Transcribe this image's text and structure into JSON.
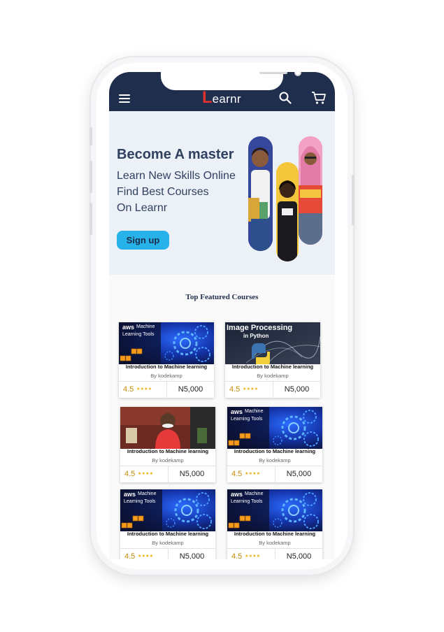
{
  "header": {
    "menu_icon": "hamburger-menu-icon",
    "logo_initial": "L",
    "logo_text": "earnr",
    "search_icon": "search-icon",
    "cart_icon": "shopping-cart-icon",
    "background": "#1f2e4d"
  },
  "hero": {
    "title": "Become A master",
    "lines": [
      "Learn New Skills Online",
      "Find Best Courses",
      "On Learnr"
    ],
    "signup_label": "Sign up",
    "accent": "#27b3e9"
  },
  "featured": {
    "title": "Top Featured Courses"
  },
  "courses": [
    {
      "thumb": "aws",
      "aws_logo": "aws",
      "aws_tag": "Machine",
      "aws_sub": "Learning Tools",
      "title": "Introduction to Machine learning",
      "author": "By kodekamp",
      "rating": "4.5",
      "stars": "★★★★",
      "price": "N5,000"
    },
    {
      "thumb": "image-processing",
      "ip_title": "Image Processing",
      "ip_sub": "in Python",
      "title": "Introduction to Machine learning",
      "author": "By kodekamp",
      "rating": "4.5",
      "stars": "★★★★",
      "price": "N5,000"
    },
    {
      "thumb": "photo",
      "title": "Introduction to Machine learning",
      "author": "By kodekamp",
      "rating": "4.5",
      "stars": "★★★★",
      "price": "N5,000"
    },
    {
      "thumb": "aws",
      "aws_logo": "aws",
      "aws_tag": "Machine",
      "aws_sub": "Learning Tools",
      "title": "Introduction to Machine learning",
      "author": "By kodekamp",
      "rating": "4.5",
      "stars": "★★★★",
      "price": "N5,000"
    },
    {
      "thumb": "aws",
      "aws_logo": "aws",
      "aws_tag": "Machine",
      "aws_sub": "Learning Tools",
      "title": "Introduction to Machine learning",
      "author": "By kodekamp",
      "rating": "4.5",
      "stars": "★★★★",
      "price": "N5,000"
    },
    {
      "thumb": "aws",
      "aws_logo": "aws",
      "aws_tag": "Machine",
      "aws_sub": "Learning Tools",
      "title": "Introduction to Machine learning",
      "author": "By kodekamp",
      "rating": "4.5",
      "stars": "★★★★",
      "price": "N5,000"
    }
  ]
}
